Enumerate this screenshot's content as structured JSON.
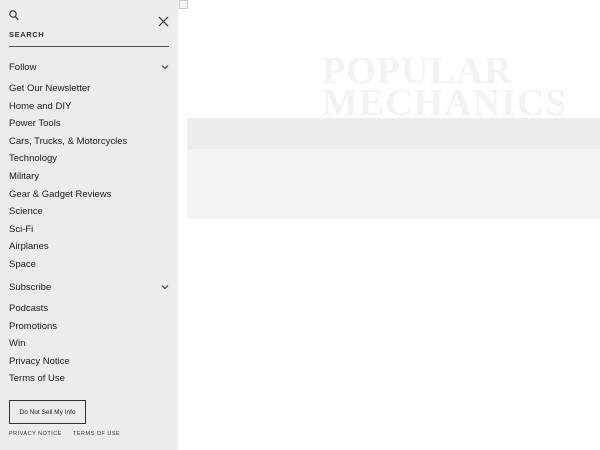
{
  "search": {
    "label": "SEARCH"
  },
  "logo": {
    "line1": "POPULAR",
    "line2": "MECHANICS"
  },
  "follow": {
    "label": "Follow",
    "items": [
      "Get Our Newsletter",
      "Home and DIY",
      "Power Tools",
      "Cars, Trucks, & Motorcycles",
      "Technology",
      "Military",
      "Gear & Gadget Reviews",
      "Science",
      "Sci-Fi",
      "Airplanes",
      "Space"
    ]
  },
  "subscribe": {
    "label": "Subscribe",
    "items": [
      "Podcasts",
      "Promotions",
      "Win",
      "Privacy Notice",
      "Terms of Use"
    ]
  },
  "footer": {
    "dns_label": "Do Not Sell My Info",
    "privacy_label": "PRIVACY NOTICE",
    "terms_label": "TERMS OF USE"
  },
  "icons": {
    "search": "search-icon",
    "close": "close-icon",
    "chevron": "chevron-down-icon"
  },
  "colors": {
    "sidebar_bg": "#ececec",
    "text": "#1a1a1a"
  }
}
